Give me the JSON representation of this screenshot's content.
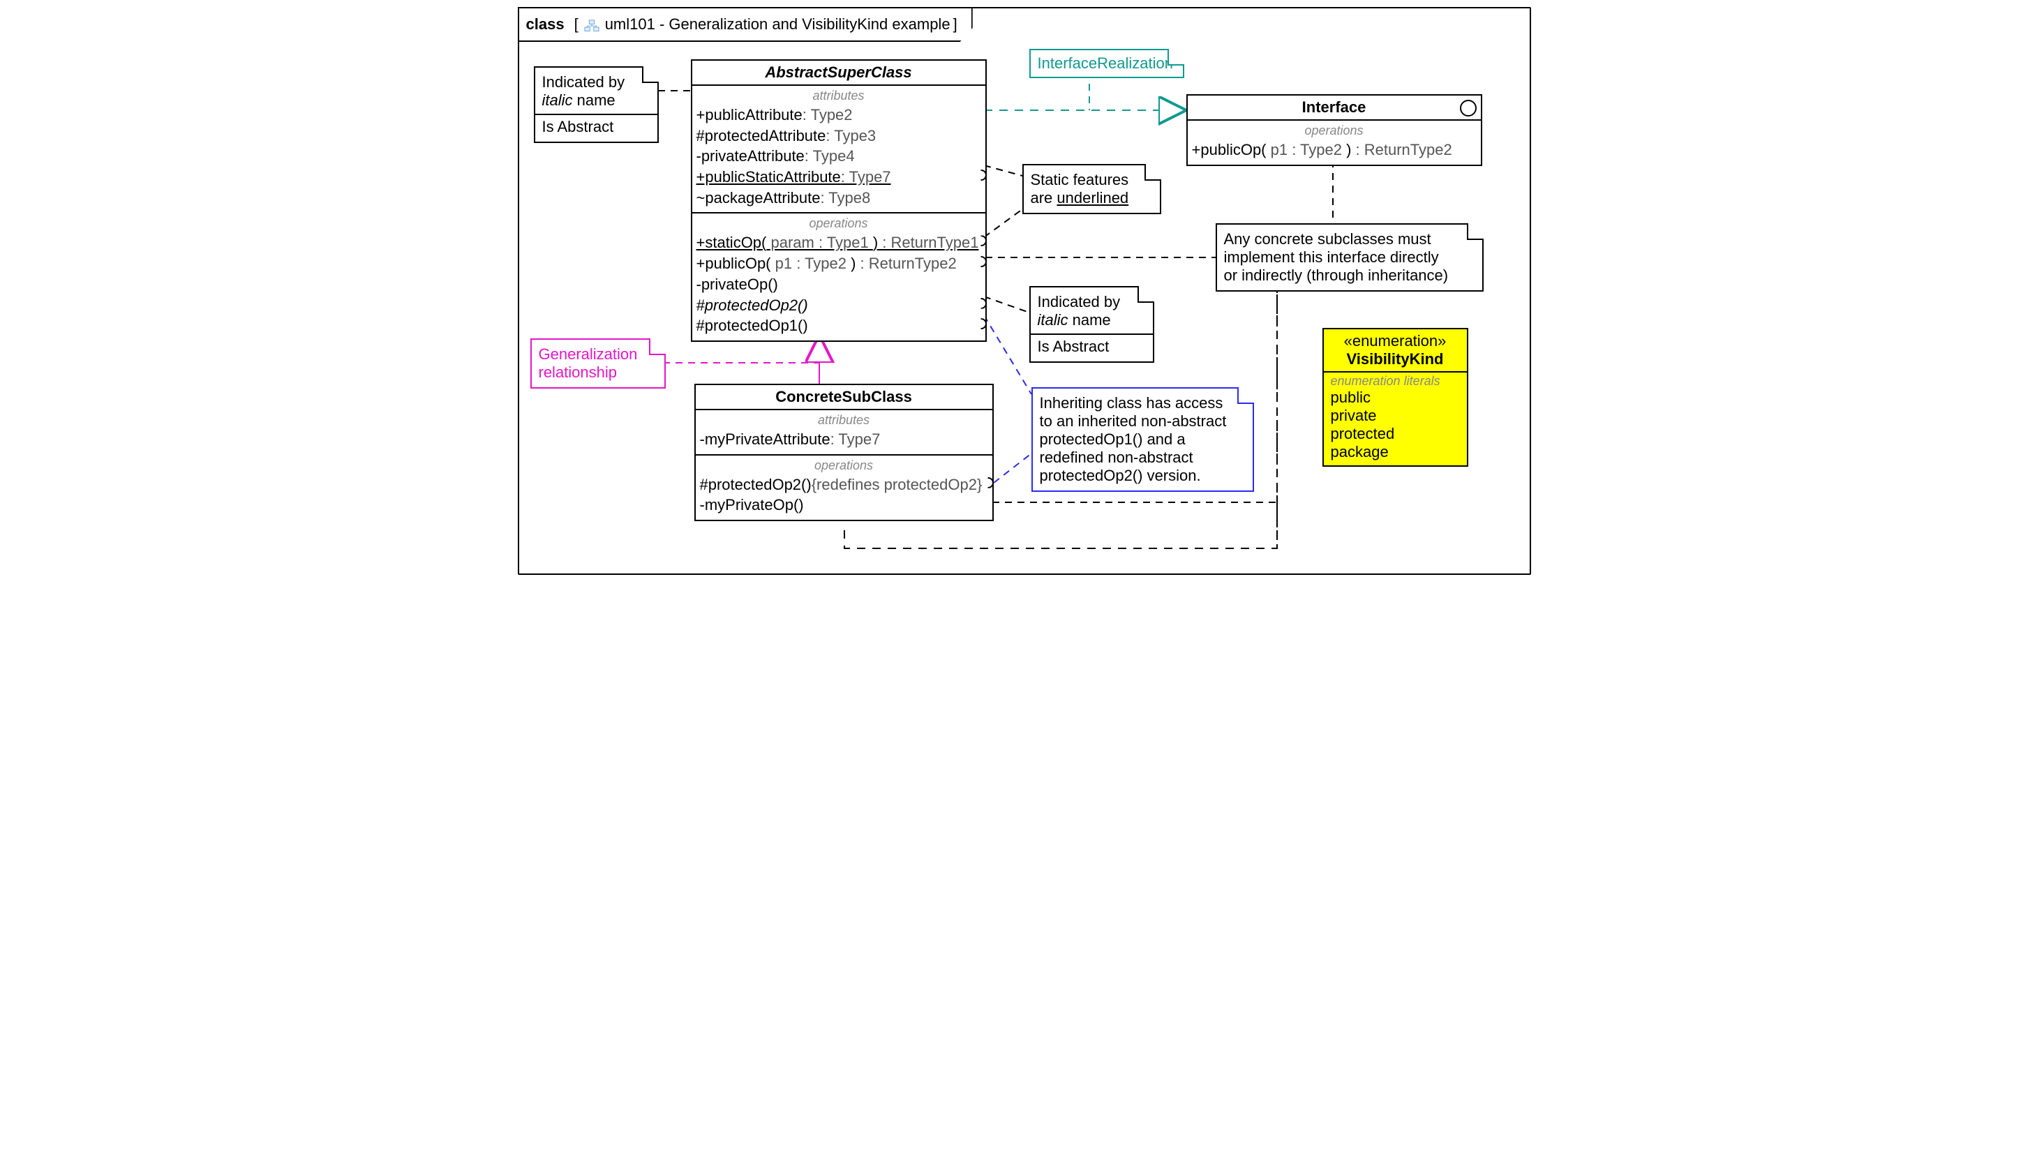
{
  "frame": {
    "keyword": "class",
    "title": "uml101 - Generalization and VisibilityKind example"
  },
  "abstractClass": {
    "name": "AbstractSuperClass",
    "attrHeader": "attributes",
    "opHeader": "operations",
    "a1": "+publicAttribute",
    "a1t": ": Type2",
    "a2": "#protectedAttribute",
    "a2t": ": Type3",
    "a3": "-privateAttribute",
    "a3t": ": Type4",
    "a4": "+publicStaticAttribute",
    "a4t": ": Type7",
    "a5": "~packageAttribute",
    "a5t": ": Type8",
    "o1a": "+staticOp(",
    "o1b": " param : Type1 ",
    "o1c": ")",
    "o1d": " : ReturnType1",
    "o2a": "+publicOp(",
    "o2b": " p1 : Type2 ",
    "o2c": ")",
    "o2d": " : ReturnType2",
    "o3": "-privateOp()",
    "o4": "#protectedOp2()",
    "o5": "#protectedOp1()"
  },
  "interface": {
    "name": "Interface",
    "opHeader": "operations",
    "o1a": "+publicOp(",
    "o1b": " p1 : Type2 ",
    "o1c": ")",
    "o1d": " : ReturnType2"
  },
  "concreteClass": {
    "name": "ConcreteSubClass",
    "attrHeader": "attributes",
    "opHeader": "operations",
    "a1": "-myPrivateAttribute",
    "a1t": ": Type7",
    "o1": "#protectedOp2()",
    "o1r": "{redefines protectedOp2}",
    "o2": "-myPrivateOp()"
  },
  "enum": {
    "stereo": "«enumeration»",
    "name": "VisibilityKind",
    "hdr": "enumeration literals",
    "l1": "public",
    "l2": "private",
    "l3": "protected",
    "l4": "package"
  },
  "notes": {
    "abstract1_l1": "Indicated by",
    "abstract1_l2a": "italic",
    "abstract1_l2b": " name",
    "abstract1_cap": "Is Abstract",
    "realization": "InterfaceRealization",
    "static_l1": "Static features",
    "static_l2a": "are ",
    "static_l2b": "underlined",
    "abstract2_l1": "Indicated by",
    "abstract2_l2a": "italic",
    "abstract2_l2b": " name",
    "abstract2_cap": "Is Abstract",
    "generalization_l1": "Generalization",
    "generalization_l2": "relationship",
    "inheriting_l1": "Inheriting class has access",
    "inheriting_l2": "to an inherited non-abstract",
    "inheriting_l3": "protectedOp1() and a",
    "inheriting_l4": "redefined non-abstract",
    "inheriting_l5": "protectedOp2() version.",
    "impl_l1": "Any concrete subclasses must",
    "impl_l2": "implement this interface directly",
    "impl_l3": "or indirectly (through inheritance)"
  }
}
